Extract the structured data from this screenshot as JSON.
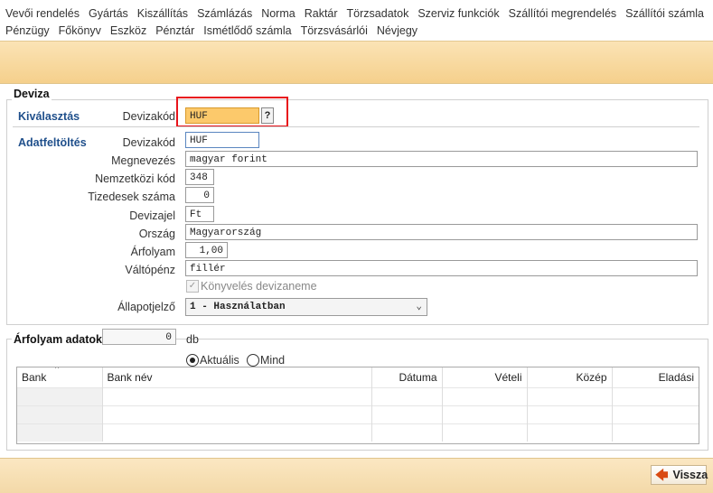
{
  "menu": {
    "row1": [
      "Vevői rendelés",
      "Gyártás",
      "Kiszállítás",
      "Számlázás",
      "Norma",
      "Raktár",
      "Törzsadatok",
      "Szerviz funkciók",
      "Szállítói megrendelés",
      "Szállítói számla"
    ],
    "row2": [
      "Pénzügy",
      "Főkönyv",
      "Eszköz",
      "Pénztár",
      "Ismétlődő számla",
      "Törzsvásárlói",
      "Névjegy"
    ]
  },
  "form": {
    "group_title": "Deviza",
    "select_section": "Kiválasztás",
    "select_label": "Devizakód",
    "select_value": "HUF",
    "lookup_button": "?",
    "data_section": "Adatfeltöltés",
    "fields": {
      "devizakod": {
        "label": "Devizakód",
        "value": "HUF"
      },
      "megnevezes": {
        "label": "Megnevezés",
        "value": "magyar forint"
      },
      "nemzetkozi": {
        "label": "Nemzetközi kód",
        "value": "348"
      },
      "tizedesek": {
        "label": "Tizedesek száma",
        "value": "0"
      },
      "devizajel": {
        "label": "Devizajel",
        "value": "Ft"
      },
      "orszag": {
        "label": "Ország",
        "value": "Magyarország"
      },
      "arfolyam": {
        "label": "Árfolyam",
        "value": "1,00"
      },
      "valtopenz": {
        "label": "Váltópénz",
        "value": "fillér"
      }
    },
    "checkbox_label": "Könyvelés devizaneme",
    "status_label": "Állapotjelző",
    "status_value": "1 - Használatban"
  },
  "rates": {
    "title": "Árfolyam adatok",
    "count": "0",
    "count_unit": "db",
    "radio_current": "Aktuális",
    "radio_all": "Mind",
    "columns": [
      "Bank",
      "Bank név",
      "Dátuma",
      "Vételi",
      "Közép",
      "Eladási"
    ]
  },
  "footer": {
    "back_label": "Vissza"
  },
  "colors": {
    "banner": "#f5d08c",
    "highlight": "#e8141b",
    "selected_field": "#fcc96b",
    "section": "#1f4f8b"
  }
}
